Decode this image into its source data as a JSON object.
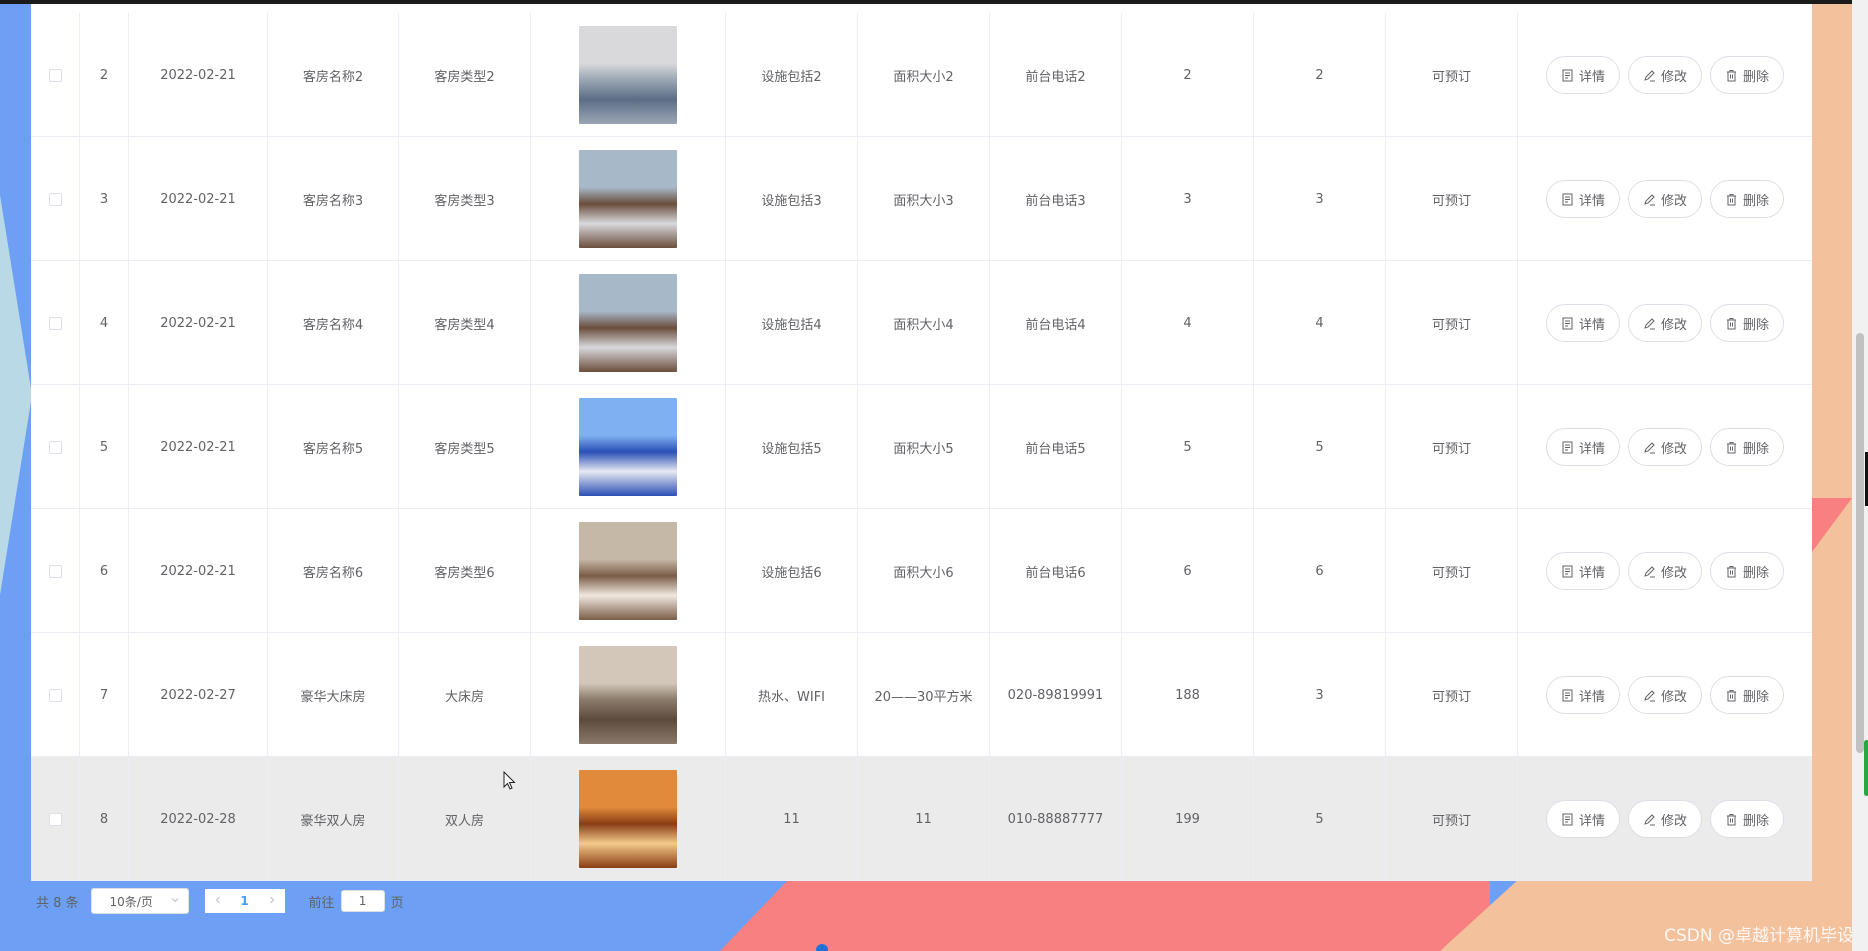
{
  "colors": {
    "accent": "#409eff",
    "bg_blue": "#6da0f5",
    "bg_pink": "#f98080",
    "bg_peach": "#f3c19c"
  },
  "actions": {
    "detail": "详情",
    "edit": "修改",
    "delete": "删除"
  },
  "rows": [
    {
      "index": "2",
      "date": "2022-02-21",
      "name": "客房名称2",
      "type": "客房类型2",
      "facilities": "设施包括2",
      "area": "面积大小2",
      "phone": "前台电话2",
      "price": "2",
      "count": "2",
      "status": "可预订",
      "image": "room-photo"
    },
    {
      "index": "3",
      "date": "2022-02-21",
      "name": "客房名称3",
      "type": "客房类型3",
      "facilities": "设施包括3",
      "area": "面积大小3",
      "phone": "前台电话3",
      "price": "3",
      "count": "3",
      "status": "可预订",
      "image": "room-photo"
    },
    {
      "index": "4",
      "date": "2022-02-21",
      "name": "客房名称4",
      "type": "客房类型4",
      "facilities": "设施包括4",
      "area": "面积大小4",
      "phone": "前台电话4",
      "price": "4",
      "count": "4",
      "status": "可预订",
      "image": "room-photo"
    },
    {
      "index": "5",
      "date": "2022-02-21",
      "name": "客房名称5",
      "type": "客房类型5",
      "facilities": "设施包括5",
      "area": "面积大小5",
      "phone": "前台电话5",
      "price": "5",
      "count": "5",
      "status": "可预订",
      "image": "room-photo"
    },
    {
      "index": "6",
      "date": "2022-02-21",
      "name": "客房名称6",
      "type": "客房类型6",
      "facilities": "设施包括6",
      "area": "面积大小6",
      "phone": "前台电话6",
      "price": "6",
      "count": "6",
      "status": "可预订",
      "image": "room-photo"
    },
    {
      "index": "7",
      "date": "2022-02-27",
      "name": "豪华大床房",
      "type": "大床房",
      "facilities": "热水、WIFI",
      "area": "20——30平方米",
      "phone": "020-89819991",
      "price": "188",
      "count": "3",
      "status": "可预订",
      "image": "room-photo"
    },
    {
      "index": "8",
      "date": "2022-02-28",
      "name": "豪华双人房",
      "type": "双人房",
      "facilities": "11",
      "area": "11",
      "phone": "010-88887777",
      "price": "199",
      "count": "5",
      "status": "可预订",
      "image": "room-photo"
    }
  ],
  "pagination": {
    "total": "共 8 条",
    "page_size": "10条/页",
    "current_page": "1",
    "goto_label": "前往",
    "goto_value": "1",
    "page_suffix": "页"
  },
  "watermark": "CSDN @卓越计算机毕设"
}
